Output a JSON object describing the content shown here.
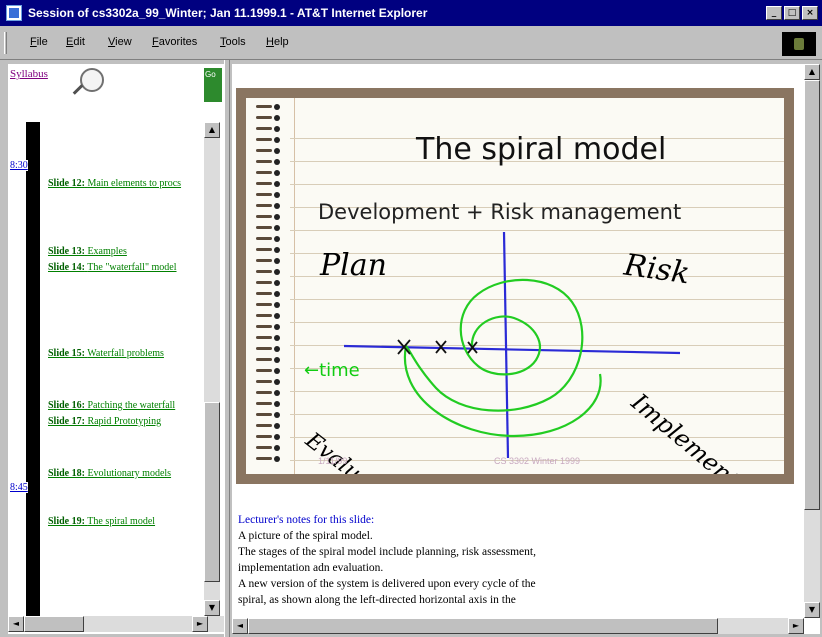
{
  "window": {
    "title": "Session of cs3302a_99_Winter; Jan 11.1999.1 - AT&T Internet Explorer",
    "minimize": "_",
    "maximize": "□",
    "close": "×"
  },
  "menu": {
    "items": [
      {
        "label": "File",
        "ul": "F",
        "rest": "ile"
      },
      {
        "label": "Edit",
        "ul": "E",
        "rest": "dit"
      },
      {
        "label": "View",
        "ul": "V",
        "rest": "iew"
      },
      {
        "label": "Favorites",
        "ul": "F",
        "rest": "avorites"
      },
      {
        "label": "Tools",
        "ul": "T",
        "rest": "ools"
      },
      {
        "label": "Help",
        "ul": "H",
        "rest": "elp"
      }
    ]
  },
  "left_frame": {
    "syllabus": "Syllabus",
    "nav_tab": "Go",
    "time_marks": [
      "8:30",
      "8:45"
    ],
    "slides": [
      {
        "num": "Slide 12:",
        "title": "Main elements to procs"
      },
      {
        "num": "Slide 13:",
        "title": "Examples"
      },
      {
        "num": "Slide 14:",
        "title": "The \"waterfall\" model"
      },
      {
        "num": "Slide 15:",
        "title": "Waterfall problems"
      },
      {
        "num": "Slide 16:",
        "title": "Patching the waterfall"
      },
      {
        "num": "Slide 17:",
        "title": "Rapid Prototyping"
      },
      {
        "num": "Slide 18:",
        "title": "Evolutionary models"
      },
      {
        "num": "Slide 19:",
        "title": "The spiral model"
      }
    ]
  },
  "slide": {
    "title": "The spiral model",
    "subtitle": "Development + Risk management",
    "plan": "Plan",
    "risk": "Risk",
    "evaluate": "Evaluate",
    "implement": "Implement",
    "time": "←time",
    "date": "1/11/99",
    "footer": "CS 3302 Winter 1999",
    "colors": {
      "axis": "#2a2ad6",
      "spiral": "#22cc22",
      "board": "#8a7561"
    }
  },
  "notes": {
    "heading": "Lecturer's notes for this slide:",
    "lines": [
      "A picture of the spiral model.",
      "The stages of the spiral model include planning, risk assessment,",
      "implementation adn evaluation.",
      "A new version of the system is delivered upon every cycle of the",
      "spiral, as shown along the left-directed horizontal axis in the"
    ]
  },
  "scroll": {
    "up": "▲",
    "down": "▼",
    "left": "◄",
    "right": "►"
  }
}
